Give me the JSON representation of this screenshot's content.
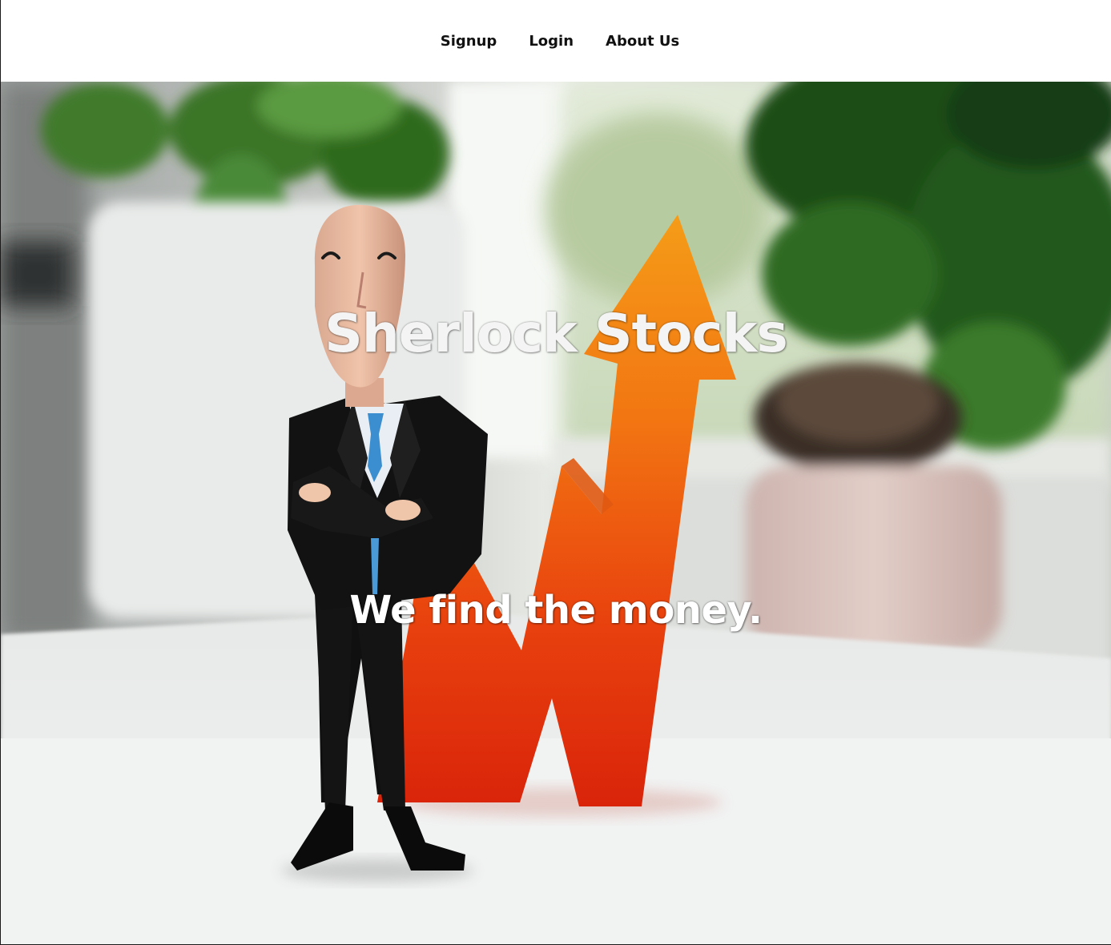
{
  "nav": {
    "items": [
      {
        "label": "Signup"
      },
      {
        "label": "Login"
      },
      {
        "label": "About Us"
      }
    ]
  },
  "hero": {
    "title": "Sherlock Stocks",
    "subtitle": "We find the money.",
    "background": "photo-figurine-businessman-with-rising-arrow"
  },
  "colors": {
    "nav_text": "#111111",
    "hero_text": "#ffffff",
    "arrow_orange": "#f07a12",
    "arrow_red": "#e02a0c"
  }
}
